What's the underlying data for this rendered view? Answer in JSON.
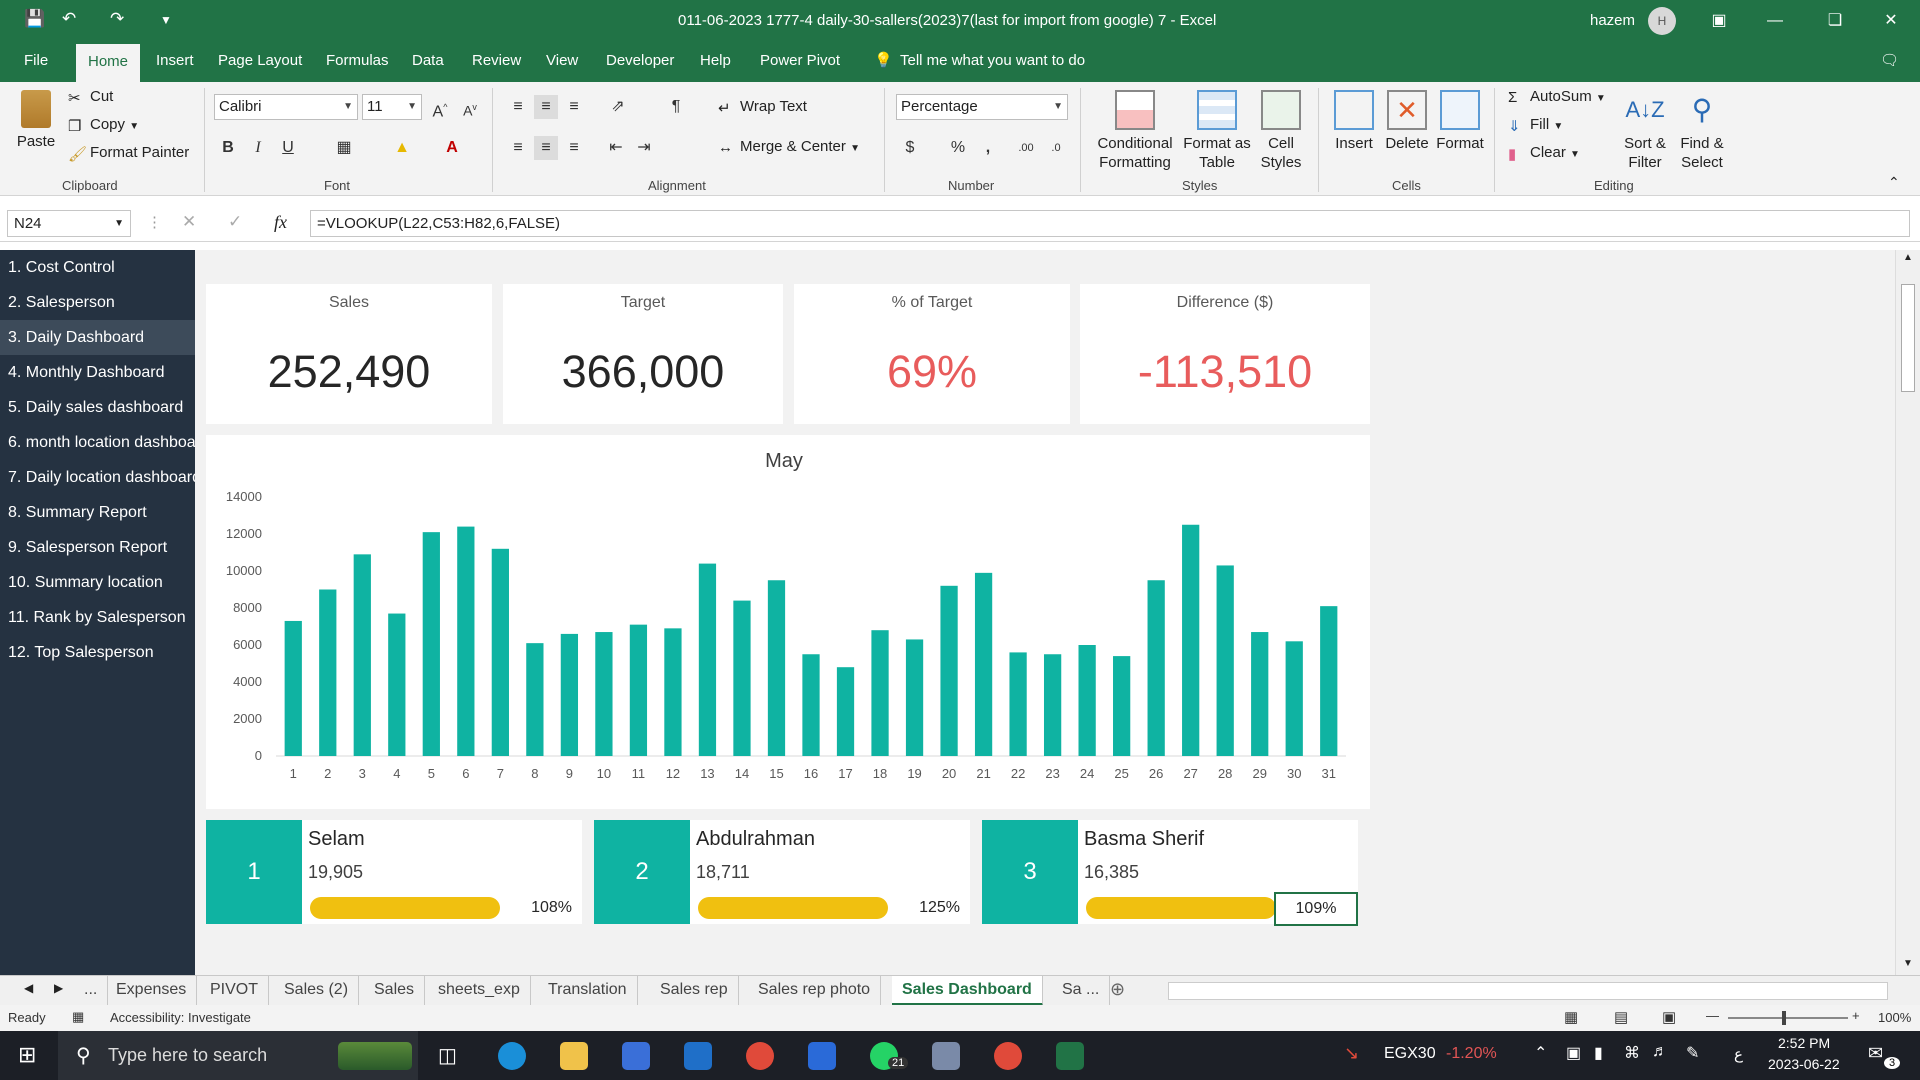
{
  "titlebar": {
    "title": "011-06-2023    1777-4 daily-30-sallers(2023)7(last for import from google) 7  -  Excel",
    "user": "hazem",
    "avatar": "H"
  },
  "menu": [
    "File",
    "Home",
    "Insert",
    "Page Layout",
    "Formulas",
    "Data",
    "Review",
    "View",
    "Developer",
    "Help",
    "Power Pivot",
    "Tell me what you want to do"
  ],
  "ribbon": {
    "clipboard": {
      "paste": "Paste",
      "cut": "Cut",
      "copy": "Copy",
      "format_painter": "Format Painter",
      "label": "Clipboard"
    },
    "font": {
      "name": "Calibri",
      "size": "11",
      "bold": "B",
      "italic": "I",
      "underline": "U",
      "label": "Font"
    },
    "alignment": {
      "wrap": "Wrap Text",
      "merge": "Merge & Center",
      "label": "Alignment"
    },
    "number": {
      "format": "Percentage",
      "currency": "$",
      "percent": "%",
      "comma": ",",
      "label": "Number"
    },
    "styles": {
      "conditional": "Conditional",
      "conditional2": "Formatting",
      "format_table": "Format as",
      "format_table2": "Table",
      "cell_styles": "Cell",
      "cell_styles2": "Styles",
      "label": "Styles"
    },
    "cells": {
      "insert": "Insert",
      "delete": "Delete",
      "format": "Format",
      "label": "Cells"
    },
    "editing": {
      "autosum": "AutoSum",
      "fill": "Fill",
      "clear": "Clear",
      "sort": "Sort &",
      "sort2": "Filter",
      "find": "Find &",
      "find2": "Select",
      "label": "Editing"
    }
  },
  "formula_bar": {
    "cell": "N24",
    "formula": "=VLOOKUP(L22,C53:H82,6,FALSE)",
    "fx": "fx"
  },
  "sidebar": [
    "1. Cost Control",
    "2. Salesperson",
    "3. Daily Dashboard",
    "4. Monthly Dashboard",
    "5. Daily sales dashboard",
    "6. month location dashboard",
    "7. Daily location dashboard",
    "8. Summary Report",
    "9. Salesperson Report",
    "10. Summary location",
    "11. Rank by Salesperson",
    "12. Top Salesperson"
  ],
  "kpis": [
    {
      "label": "Sales",
      "value": "252,490"
    },
    {
      "label": "Target",
      "value": "366,000"
    },
    {
      "label": "% of Target",
      "value": "69%"
    },
    {
      "label": "Difference ($)",
      "value": "-113,510"
    }
  ],
  "chart_data": {
    "type": "bar",
    "title": "May",
    "categories": [
      "1",
      "2",
      "3",
      "4",
      "5",
      "6",
      "7",
      "8",
      "9",
      "10",
      "11",
      "12",
      "13",
      "14",
      "15",
      "16",
      "17",
      "18",
      "19",
      "20",
      "21",
      "22",
      "23",
      "24",
      "25",
      "26",
      "27",
      "28",
      "29",
      "30",
      "31"
    ],
    "values": [
      7300,
      9000,
      10900,
      7700,
      12100,
      12400,
      11200,
      6100,
      6600,
      6700,
      7100,
      6900,
      10400,
      8400,
      9500,
      5500,
      4800,
      6800,
      6300,
      9200,
      9900,
      5600,
      5500,
      6000,
      5400,
      9500,
      12500,
      10300,
      6700,
      6200,
      8100
    ],
    "ylim": [
      0,
      14000
    ],
    "yticks": [
      "0",
      "2000",
      "4000",
      "6000",
      "8000",
      "10000",
      "12000",
      "14000"
    ],
    "bar_color": "#0fb3a2"
  },
  "top_sellers": [
    {
      "rank": "1",
      "name": "Selam",
      "sales": "19,905",
      "pct": "108%"
    },
    {
      "rank": "2",
      "name": "Abdulrahman",
      "sales": "18,711",
      "pct": "125%"
    },
    {
      "rank": "3",
      "name": "Basma Sherif",
      "sales": "16,385",
      "pct": "109%"
    }
  ],
  "sheet_tabs": [
    "...",
    "Expenses",
    "PIVOT",
    "Sales (2)",
    "Sales",
    "sheets_exp",
    "Translation",
    "Sales rep",
    "Sales rep photo",
    "Sales Dashboard",
    "Sa ..."
  ],
  "status": {
    "ready": "Ready",
    "accessibility": "Accessibility: Investigate",
    "zoom": "100%"
  },
  "taskbar": {
    "search": "Type here to search",
    "ticker": "EGX30",
    "change": "-1.20%",
    "time": "2:52 PM",
    "date": "2023-06-22",
    "lang": "ع",
    "notif": "3",
    "badge": "21"
  },
  "colors": {
    "excel_green": "#217346",
    "teal": "#0fb3a2",
    "gold": "#f0c010",
    "negative": "#e85c5c",
    "sidebar": "#253241"
  }
}
